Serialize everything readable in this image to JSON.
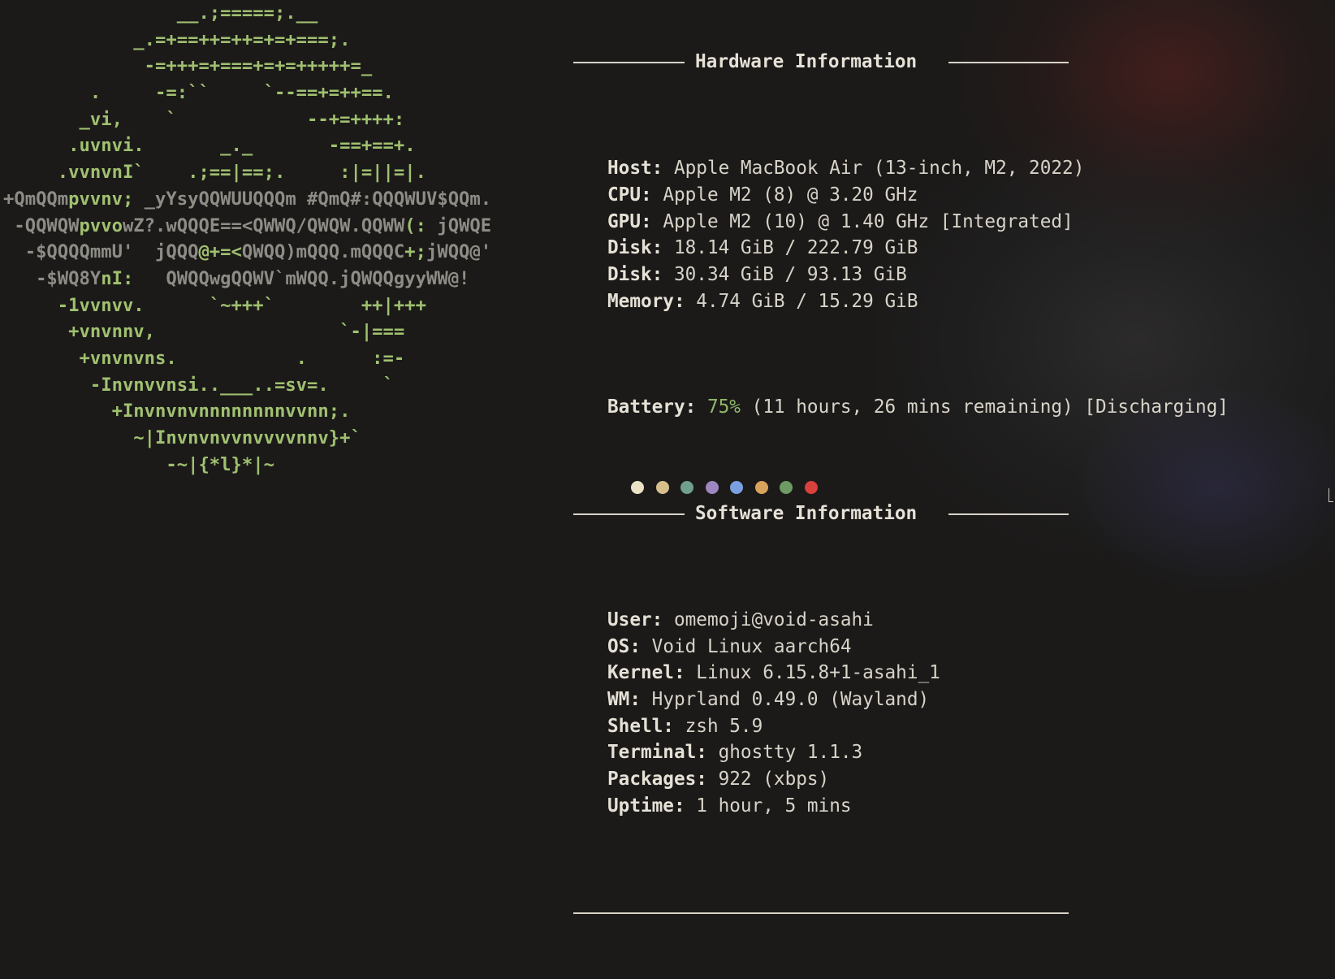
{
  "logo": {
    "lines": [
      [
        {
          "t": "                __.;=====;.__",
          "c": "g"
        }
      ],
      [
        {
          "t": "            _.=+==++=++=+=+===;.",
          "c": "g"
        }
      ],
      [
        {
          "t": "             -=+++=+===+=+=+++++=_",
          "c": "g"
        }
      ],
      [
        {
          "t": "        .     -=:``     `--==+=++==.",
          "c": "g"
        }
      ],
      [
        {
          "t": "       _vi,    `            --+=++++:",
          "c": "g"
        }
      ],
      [
        {
          "t": "      .uvnvi.       _._       -==+==+.",
          "c": "g"
        }
      ],
      [
        {
          "t": "     .vvnvnI`    .;==|==;.     :|=||=|.",
          "c": "g"
        }
      ],
      [
        {
          "t": "+QmQQm",
          "c": "k"
        },
        {
          "t": "pvvnv;",
          "c": "g"
        },
        {
          "t": " _yYsyQQWUUQQQm #QmQ#:QQQWUV$QQm.",
          "c": "k"
        }
      ],
      [
        {
          "t": " -QQWQW",
          "c": "k"
        },
        {
          "t": "pvvo",
          "c": "g"
        },
        {
          "t": "wZ?.wQQQE==<QWWQ/QWQW.QQWW",
          "c": "k"
        },
        {
          "t": "(:",
          "c": "g"
        },
        {
          "t": " jQWQE",
          "c": "k"
        }
      ],
      [
        {
          "t": "  -$QQQQmmU'  jQQQ",
          "c": "k"
        },
        {
          "t": "@+=<",
          "c": "g"
        },
        {
          "t": "QWQQ)mQQQ.mQQQC",
          "c": "k"
        },
        {
          "t": "+;",
          "c": "g"
        },
        {
          "t": "jWQQ@'",
          "c": "k"
        }
      ],
      [
        {
          "t": "   -$WQ8Y",
          "c": "k"
        },
        {
          "t": "nI:",
          "c": "g"
        },
        {
          "t": "   QWQQwgQQWV`mWQQ.jQWQQgyyWW@!",
          "c": "k"
        }
      ],
      [
        {
          "t": "     -1vvnvv.      `~+++`        ++|+++",
          "c": "g"
        }
      ],
      [
        {
          "t": "      +vnvnnv,                 `-|===",
          "c": "g"
        }
      ],
      [
        {
          "t": "       +vnvnvns.           .      :=-",
          "c": "g"
        }
      ],
      [
        {
          "t": "        -Invnvvnsi..___..=sv=.     `",
          "c": "g"
        }
      ],
      [
        {
          "t": "          +Invnvnvnnnnnnnnvvnn;.",
          "c": "g"
        }
      ],
      [
        {
          "t": "            ~|Invnvnvvnvvvvnnv}+`",
          "c": "g"
        }
      ],
      [
        {
          "t": "               -~|{*l}*|~",
          "c": "g"
        }
      ]
    ]
  },
  "hardware": {
    "title": "Hardware Information",
    "rows": [
      {
        "key": "Host:",
        "value": "Apple MacBook Air (13-inch, M2, 2022)"
      },
      {
        "key": "CPU:",
        "value": "Apple M2 (8) @ 3.20 GHz"
      },
      {
        "key": "GPU:",
        "value": "Apple M2 (10) @ 1.40 GHz [Integrated]"
      },
      {
        "key": "Disk:",
        "value": "18.14 GiB / 222.79 GiB"
      },
      {
        "key": "Disk:",
        "value": "30.34 GiB / 93.13 GiB"
      },
      {
        "key": "Memory:",
        "value": "4.74 GiB / 15.29 GiB"
      }
    ],
    "battery": {
      "key": "Battery:",
      "percent": "75%",
      "rest": "(11 hours, 26 mins remaining) [Discharging]"
    }
  },
  "software": {
    "title": "Software Information",
    "rows": [
      {
        "key": "User:",
        "value": "omemoji@void-asahi"
      },
      {
        "key": "OS:",
        "value": "Void Linux aarch64"
      },
      {
        "key": "Kernel:",
        "value": "Linux 6.15.8+1-asahi_1"
      },
      {
        "key": "WM:",
        "value": "Hyprland 0.49.0 (Wayland)"
      },
      {
        "key": "Shell:",
        "value": "zsh 5.9"
      },
      {
        "key": "Terminal:",
        "value": "ghostty 1.1.3"
      },
      {
        "key": "Packages:",
        "value": "922 (xbps)"
      },
      {
        "key": "Uptime:",
        "value": "1 hour, 5 mins"
      }
    ]
  },
  "palette": [
    "#ece2c6",
    "#d7c08c",
    "#6fa08c",
    "#9e86c0",
    "#7aa0e0",
    "#d9a35c",
    "#6f9a64",
    "#d9413c"
  ],
  "colors": {
    "background": "#1b1a19",
    "logo_green": "#a0c070",
    "logo_gray": "#8d8d86",
    "text": "#d8d3c8",
    "battery_percent": "#8fb86a"
  }
}
